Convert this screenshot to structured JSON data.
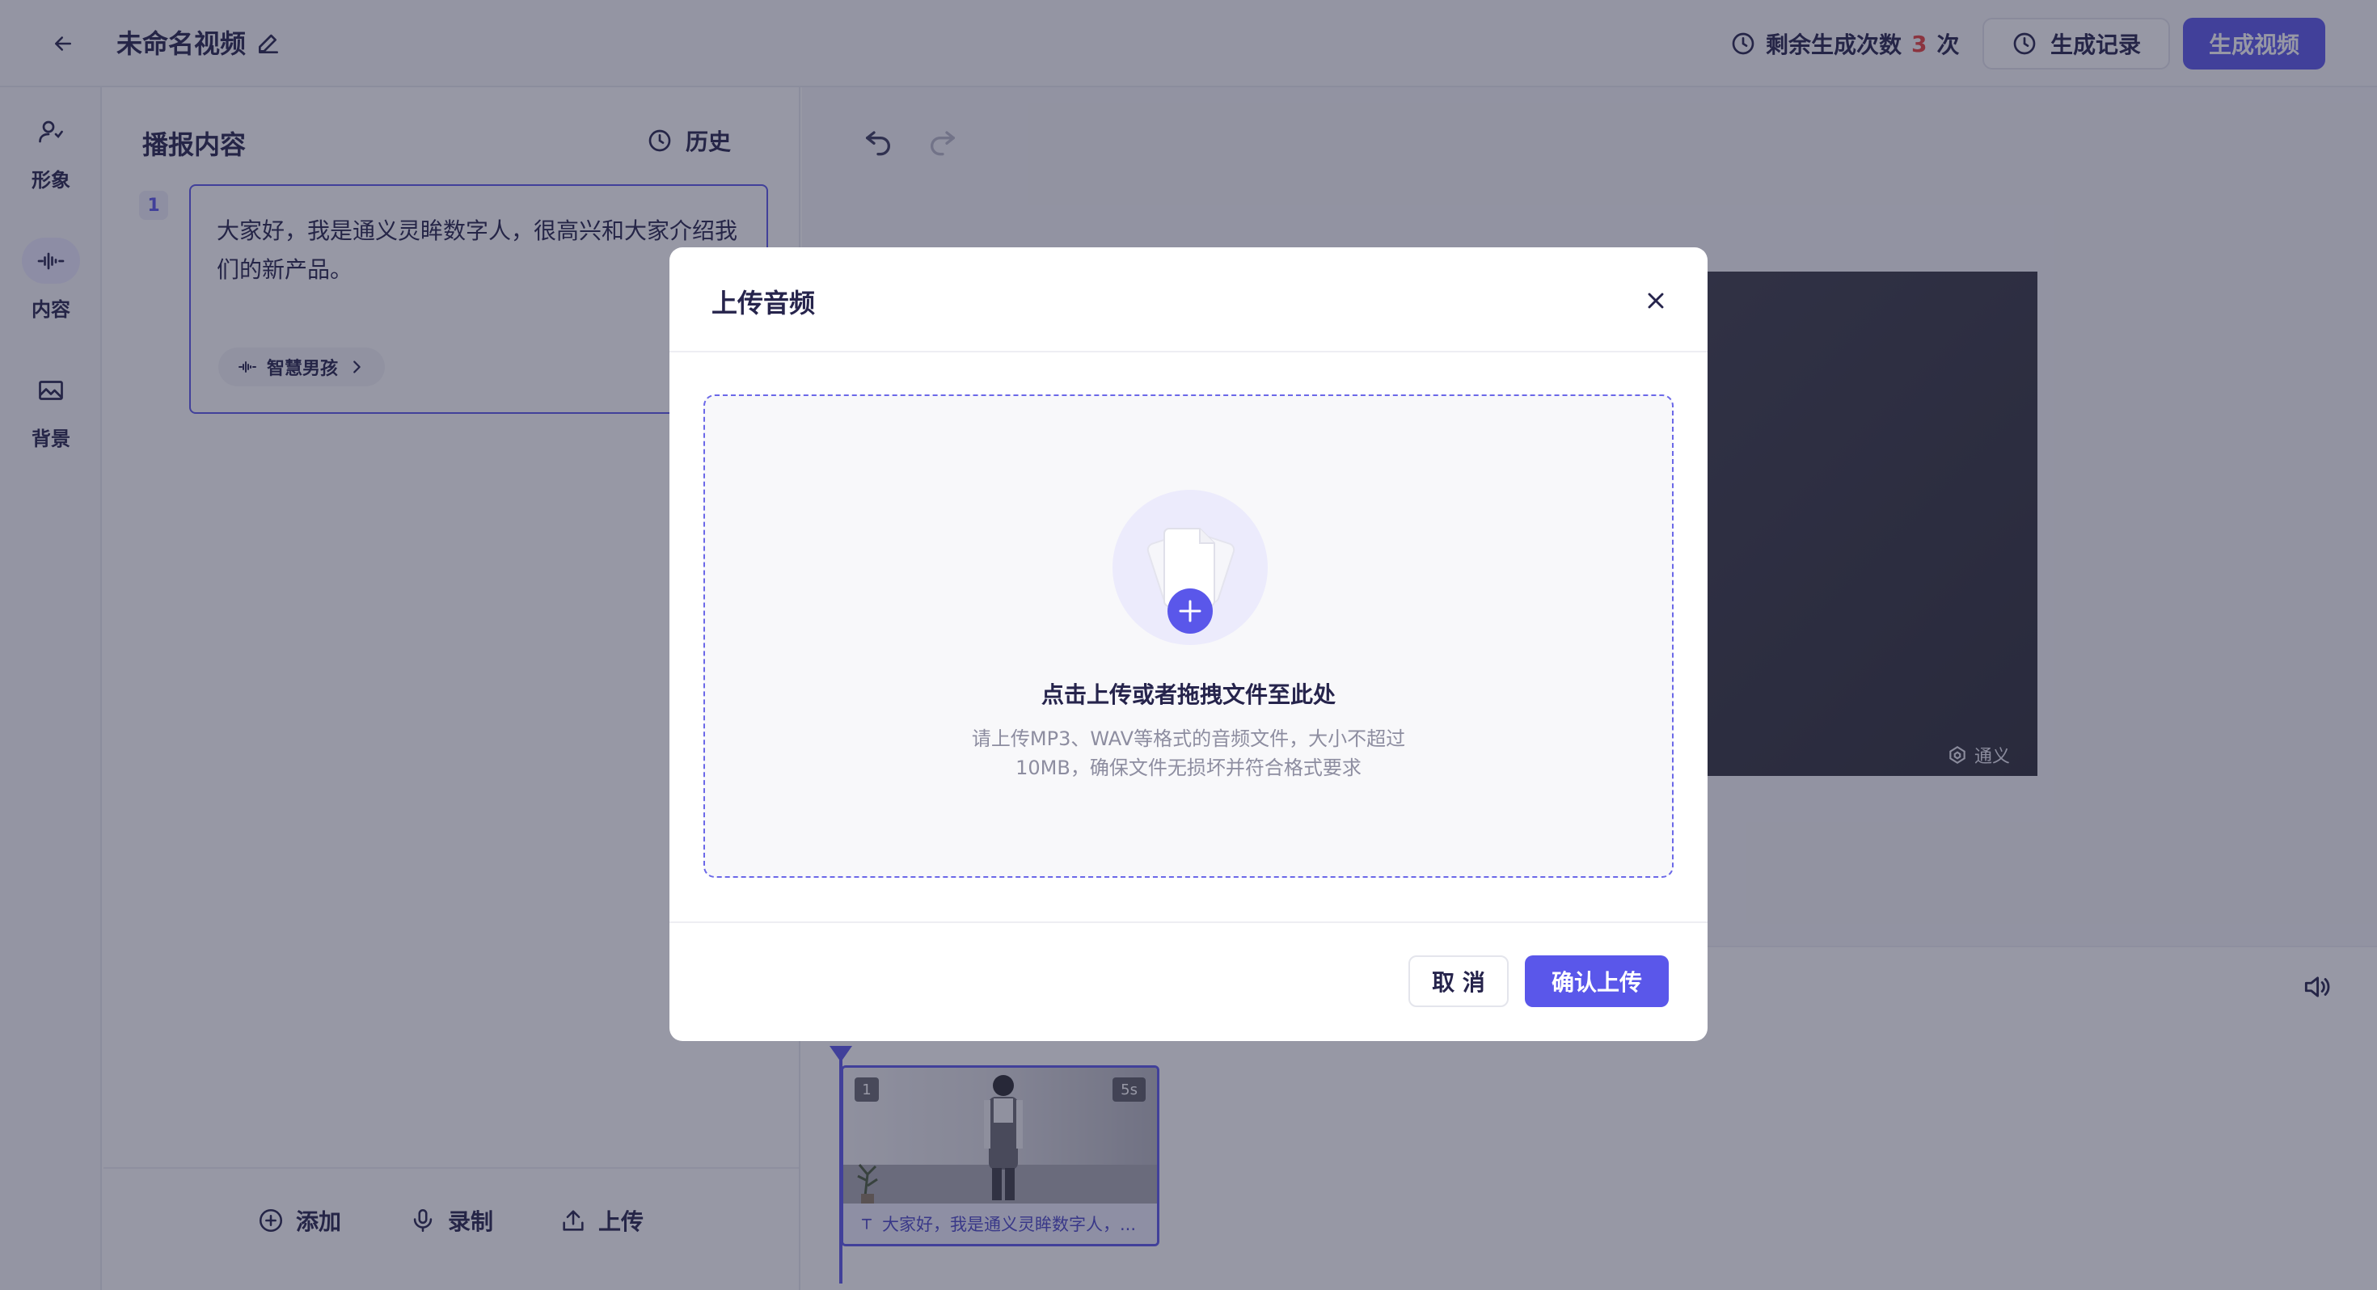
{
  "header": {
    "title": "未命名视频",
    "remaining_label": "剩余生成次数",
    "remaining_count": "3",
    "remaining_unit": "次",
    "history_record_label": "生成记录",
    "generate_label": "生成视频"
  },
  "sidebar": {
    "items": [
      {
        "label": "形象",
        "icon": "person-icon"
      },
      {
        "label": "内容",
        "icon": "waveform-icon"
      },
      {
        "label": "背景",
        "icon": "image-icon"
      }
    ]
  },
  "script_panel": {
    "title": "播报内容",
    "history_label": "历史",
    "segments": [
      {
        "number": "1",
        "text": "大家好，我是通义灵眸数字人，很高兴和大家介绍我们的新产品。",
        "voice": "智慧男孩"
      }
    ],
    "actions": {
      "add": "添加",
      "record": "录制",
      "upload": "上传"
    }
  },
  "preview": {
    "watermark": "通义"
  },
  "timeline": {
    "clips": [
      {
        "index": "1",
        "duration": "5s",
        "caption": "大家好，我是通义灵眸数字人，..."
      }
    ]
  },
  "modal": {
    "title": "上传音频",
    "drop_title": "点击上传或者拖拽文件至此处",
    "drop_hint": "请上传MP3、WAV等格式的音频文件，大小不超过10MB，确保文件无损坏并符合格式要求",
    "cancel_label": "取 消",
    "confirm_label": "确认上传"
  },
  "colors": {
    "accent": "#5a57ea",
    "count_red": "#e8403c",
    "overlay": "#262842"
  }
}
